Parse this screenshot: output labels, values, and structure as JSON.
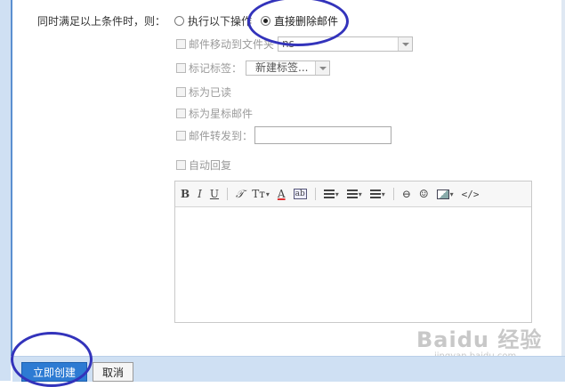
{
  "rule": {
    "condition_label": "同时满足以上条件时，则：",
    "action_options": [
      {
        "label": "执行以下操作",
        "selected": false
      },
      {
        "label": "直接删除邮件",
        "selected": true
      }
    ]
  },
  "actions": {
    "move_to_folder": {
      "label": "邮件移动到文件夹",
      "value": "ns"
    },
    "tag": {
      "label": "标记标签：",
      "value": "新建标签..."
    },
    "mark_read": {
      "label": "标为已读"
    },
    "mark_star": {
      "label": "标为星标邮件"
    },
    "forward_to": {
      "label": "邮件转发到：",
      "value": ""
    },
    "auto_reply": {
      "label": "自动回复"
    }
  },
  "editor": {
    "toolbar": {
      "bold": "B",
      "italic": "I",
      "underline": "U",
      "clear_format": "𝒯",
      "font_size": "Tт",
      "font_color": "A",
      "bg_color": "ab",
      "link": "⊖",
      "emoji": "☺",
      "code": "</>"
    },
    "body": ""
  },
  "footer": {
    "create_label": "立即创建",
    "cancel_label": "取消"
  },
  "watermark": {
    "main": "Baidu 经验",
    "sub": "jingyan.baidu.com"
  },
  "colors": {
    "primary_button": "#2d7bd3",
    "annotation_circle": "#3333bb",
    "panel_border": "#5b8fd0"
  }
}
